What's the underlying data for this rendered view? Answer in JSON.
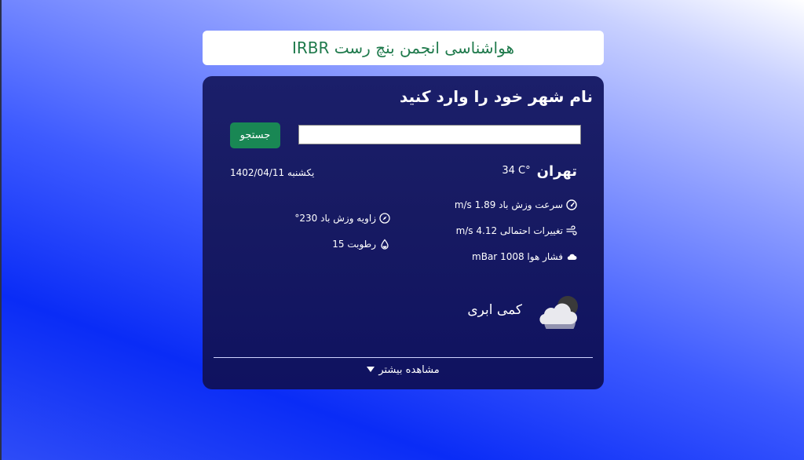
{
  "header": {
    "title": "هواشناسی انجمن بنچ رست IRBR"
  },
  "search": {
    "heading": "نام شهر خود را وارد کنید",
    "input_value": "",
    "input_placeholder": "",
    "button_label": "جستجو"
  },
  "weather": {
    "city": "تهران",
    "temperature": "34 C°",
    "date": "یکشنبه 1402/04/11",
    "wind_speed": "سرعت وزش باد 1.89 m/s",
    "gust": "تغییرات احتمالی 4.12 m/s",
    "pressure": "فشار هوا 1008 mBar",
    "wind_angle": "زاویه وزش باد 230°",
    "humidity": "رطوبت 15",
    "condition": "کمی ابری",
    "condition_icon": "partly-cloudy-icon"
  },
  "footer": {
    "more_label": "مشاهده بیشتر"
  },
  "colors": {
    "title_text": "#1f7a4c",
    "button": "#198754",
    "card": "#171a62"
  }
}
